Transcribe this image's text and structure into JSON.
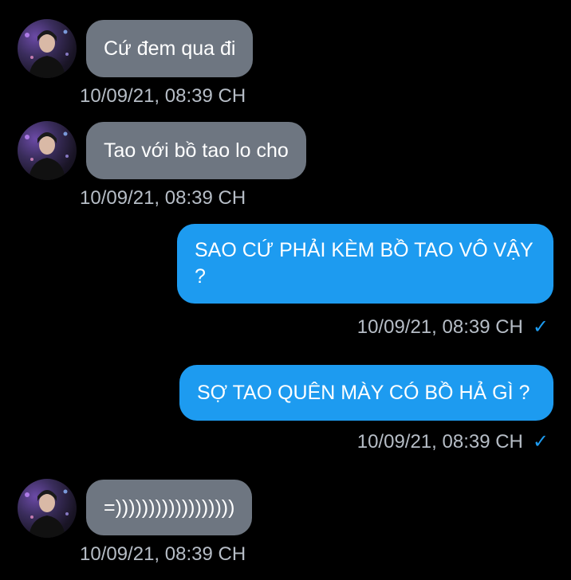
{
  "messages": [
    {
      "direction": "in",
      "text": "Cứ đem qua đi",
      "timestamp": "10/09/21, 08:39 CH"
    },
    {
      "direction": "in",
      "text": "Tao với bồ tao lo cho",
      "timestamp": "10/09/21, 08:39 CH"
    },
    {
      "direction": "out",
      "text": "SAO CỨ PHẢI KÈM BỒ TAO VÔ VẬY ?",
      "timestamp": "10/09/21, 08:39 CH",
      "read_icon": "checkmark-icon",
      "read_glyph": "✓"
    },
    {
      "direction": "out",
      "text": "SỢ TAO QUÊN MÀY CÓ BỒ HẢ GÌ ?",
      "timestamp": "10/09/21, 08:39 CH",
      "read_icon": "checkmark-icon",
      "read_glyph": "✓"
    },
    {
      "direction": "in",
      "text": "=))))))))))))))))))",
      "timestamp": "10/09/21, 08:39 CH"
    }
  ],
  "colors": {
    "background": "#000000",
    "incoming_bubble": "#6e7681",
    "outgoing_bubble": "#1d9bf0",
    "timestamp": "#b6bdc6",
    "check": "#1d9bf0"
  }
}
